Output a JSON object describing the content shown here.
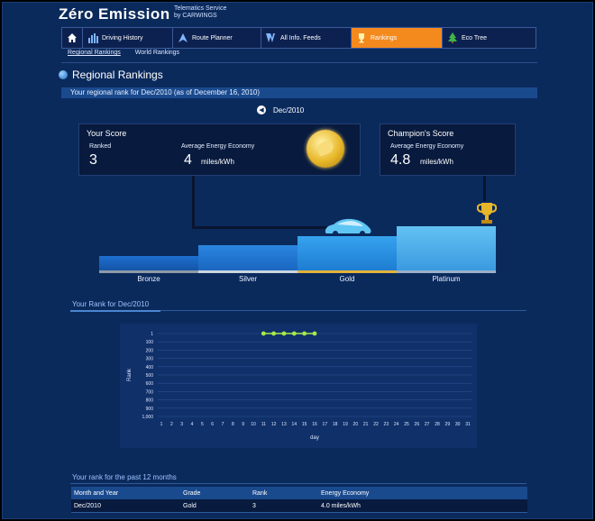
{
  "header": {
    "logo": "Zéro Emission",
    "tagline_line1": "Telematics Service",
    "tagline_line2": "by CARWINGS"
  },
  "nav": {
    "items": [
      {
        "label": "",
        "icon": "home-icon"
      },
      {
        "label": "Driving History",
        "icon": "bar-chart-icon"
      },
      {
        "label": "Route Planner",
        "icon": "arrow-icon"
      },
      {
        "label": "All Info. Feeds",
        "icon": "feed-icon"
      },
      {
        "label": "Rankings",
        "icon": "trophy-icon",
        "active": true
      },
      {
        "label": "Eco Tree",
        "icon": "tree-icon"
      }
    ],
    "active_color": "#f48a1e"
  },
  "subnav": {
    "regional": "Regional Rankings",
    "world": "World Rankings"
  },
  "page": {
    "title": "Regional Rankings",
    "bar_text": "Your regional rank for Dec/2010 (as of December 16, 2010)",
    "month": "Dec/2010"
  },
  "your_score": {
    "title": "Your Score",
    "ranked_label": "Ranked",
    "ranked_value": "3",
    "energy_label": "Average Energy Economy",
    "energy_value": "4",
    "energy_unit": "miles/kWh"
  },
  "champion": {
    "title": "Champion's Score",
    "energy_label": "Average Energy Economy",
    "energy_value": "4.8",
    "energy_unit": "miles/kWh"
  },
  "podium": {
    "levels": [
      "Bronze",
      "Silver",
      "Gold",
      "Platinum"
    ]
  },
  "rank_chart": {
    "title": "Your Rank for Dec/2010",
    "ylabel": "Rank",
    "xlabel": "day"
  },
  "chart_data": {
    "type": "line",
    "xlabel": "day",
    "ylabel": "Rank",
    "x_ticks": [
      1,
      2,
      3,
      4,
      5,
      6,
      7,
      8,
      9,
      10,
      11,
      12,
      13,
      14,
      15,
      16,
      17,
      18,
      19,
      20,
      21,
      22,
      23,
      24,
      25,
      26,
      27,
      28,
      29,
      30,
      31
    ],
    "y_ticks": [
      "1",
      "100",
      "200",
      "300",
      "400",
      "500",
      "600",
      "700",
      "800",
      "900",
      "1,000"
    ],
    "ylim": [
      1,
      1000
    ],
    "y_inverted": true,
    "series": [
      {
        "x": [
          11,
          12,
          13,
          14,
          15,
          16
        ],
        "y": [
          1,
          1,
          1,
          1,
          1,
          1
        ],
        "color": "#a6e84a"
      }
    ],
    "grid": true
  },
  "past": {
    "title": "Your rank for the past 12 months",
    "headers": [
      "Month and Year",
      "Grade",
      "Rank",
      "Energy Economy"
    ],
    "rows": [
      [
        "Dec/2010",
        "Gold",
        "3",
        "4.0 miles/kWh"
      ]
    ]
  }
}
